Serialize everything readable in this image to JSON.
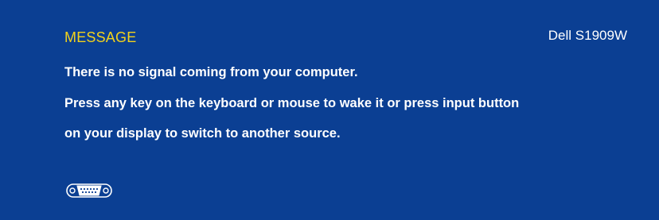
{
  "osd": {
    "title": "MESSAGE",
    "model": "Dell S1909W",
    "lines": [
      "There is no signal coming from your computer.",
      "Press any key on the keyboard or mouse to wake it or press input button",
      "on your display to switch to another source."
    ],
    "input_icon": "vga-connector-icon",
    "colors": {
      "background": "#0b3f93",
      "title": "#f2d21b",
      "text": "#ffffff"
    }
  }
}
